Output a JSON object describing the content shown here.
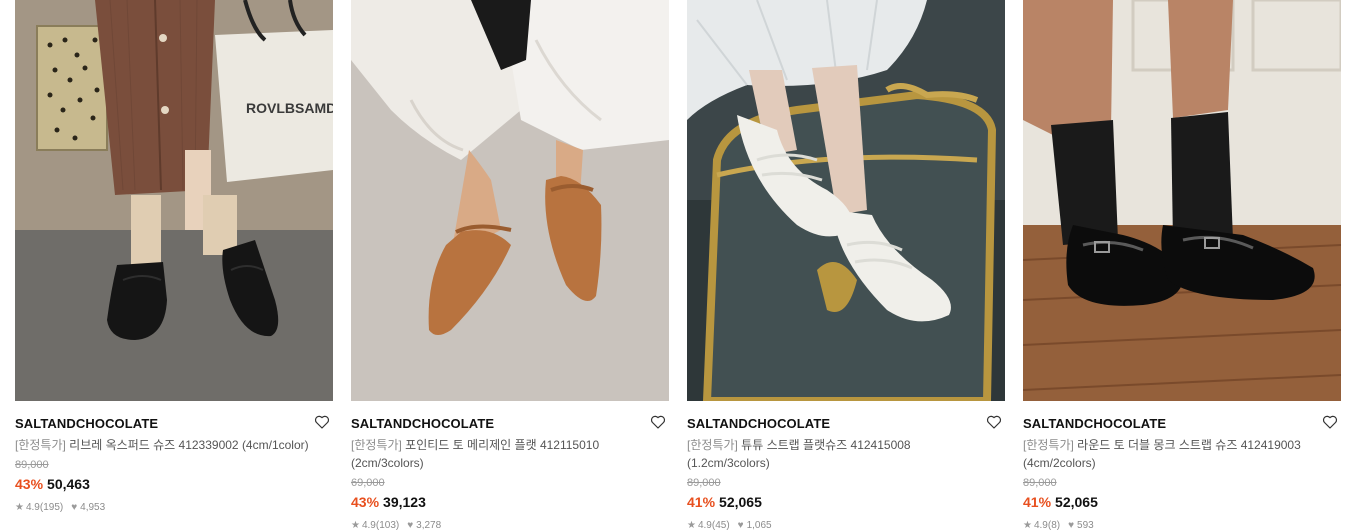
{
  "products": [
    {
      "brand": "SALTANDCHOCOLATE",
      "tag": "[한정특가]",
      "name": " 리브레 옥스퍼드 슈즈 412339002 (4cm/1color)",
      "original_price": "89,000",
      "discount": "43%",
      "price": "50,463",
      "rating": "4.9(195)",
      "likes": "4,953",
      "image": "black lace-up oxford shoes with cream socks and brown corduroy skirt"
    },
    {
      "brand": "SALTANDCHOCOLATE",
      "tag": "[한정특가]",
      "name": " 포인티드 토 메리제인 플랫 412115010 (2cm/3colors)",
      "original_price": "69,000",
      "discount": "43%",
      "price": "39,123",
      "rating": "4.9(103)",
      "likes": "3,278",
      "image": "tan pointed mary jane flats with white wide pants"
    },
    {
      "brand": "SALTANDCHOCOLATE",
      "tag": "[한정특가]",
      "name": " 튜튜 스트랩 플랫슈즈 412415008 (1.2cm/3colors)",
      "original_price": "89,000",
      "discount": "41%",
      "price": "52,065",
      "rating": "4.9(45)",
      "likes": "1,065",
      "image": "white strappy ballet flats with tulle skirt and gold mirror"
    },
    {
      "brand": "SALTANDCHOCOLATE",
      "tag": "[한정특가]",
      "name": " 라운드 토 더블 몽크 스트랩 슈즈 412419003 (4cm/2colors)",
      "original_price": "89,000",
      "discount": "41%",
      "price": "52,065",
      "rating": "4.9(8)",
      "likes": "593",
      "image": "black patent double monk strap shoes with black socks on wood floor"
    }
  ],
  "colors": {
    "discount": "#e8501f",
    "brand_text": "#111111",
    "name_text": "#555555",
    "muted": "#9a9a9a"
  },
  "icons": {
    "wishlist": "heart-outline-icon",
    "rating": "star-icon",
    "likes": "heart-icon"
  }
}
